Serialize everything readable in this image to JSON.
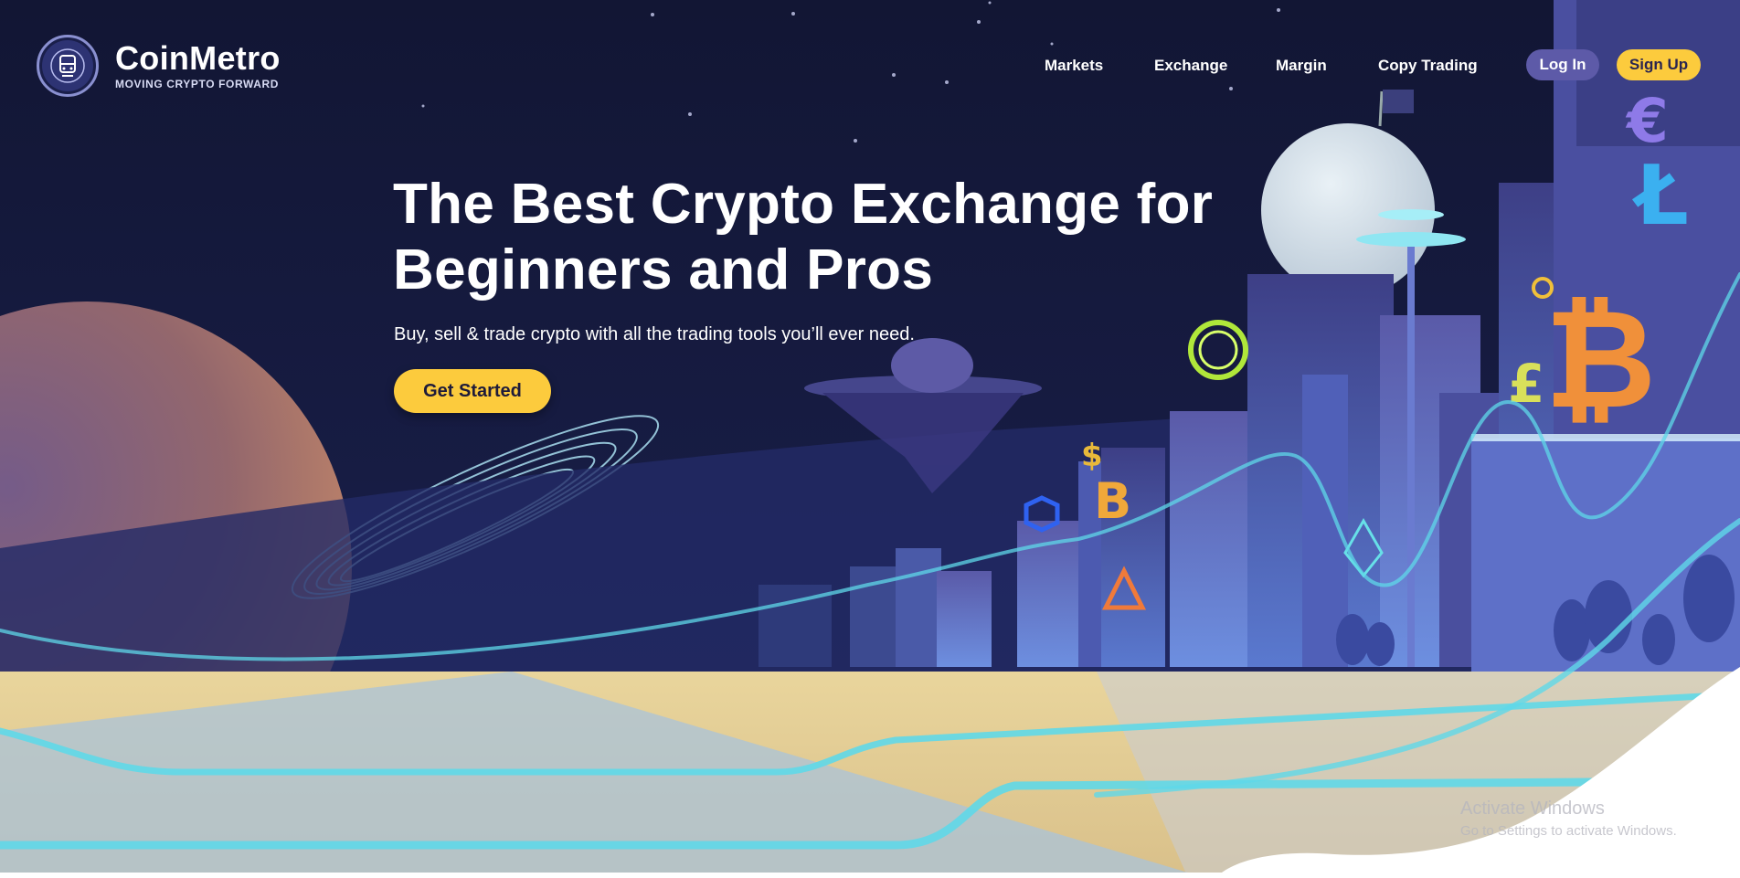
{
  "brand": {
    "name": "CoinMetro",
    "tagline": "MOVING CRYPTO FORWARD",
    "logo_icon": "train-icon"
  },
  "nav": {
    "items": [
      {
        "label": "Markets"
      },
      {
        "label": "Exchange"
      },
      {
        "label": "Margin"
      },
      {
        "label": "Copy Trading"
      }
    ],
    "login_label": "Log In",
    "signup_label": "Sign Up"
  },
  "hero": {
    "title_line1": "The Best Crypto Exchange for",
    "title_line2": "Beginners and Pros",
    "subtitle": "Buy, sell & trade crypto with all the trading tools you’ll ever need.",
    "cta_label": "Get Started"
  },
  "city_signs": {
    "euro": "€",
    "litecoin": "Ł",
    "bitcoin_large": "₿",
    "pound": "£",
    "dollar": "$",
    "bitcoin_small": "B"
  },
  "os_watermark": {
    "line1": "Activate Windows",
    "line2": "Go to Settings to activate Windows."
  },
  "colors": {
    "sky": "#131735",
    "accent_yellow": "#fccb3d",
    "login_purple": "#5d5aa8",
    "neon_cyan": "#5fd8e8",
    "sand": "#e8cf8e"
  }
}
